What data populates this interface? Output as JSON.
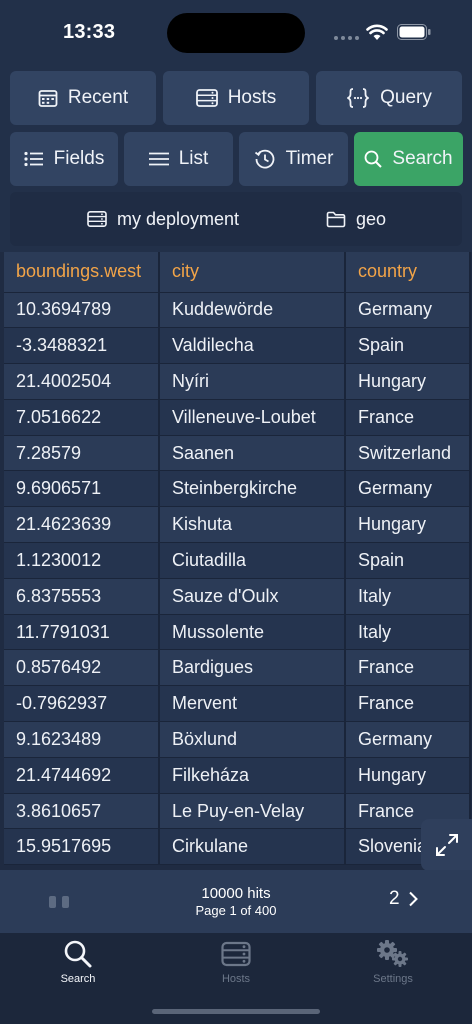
{
  "status": {
    "time": "13:33"
  },
  "toolbar": {
    "recent": "Recent",
    "hosts": "Hosts",
    "query": "Query",
    "fields": "Fields",
    "list": "List",
    "timer": "Timer",
    "search": "Search"
  },
  "deployment": {
    "name": "my deployment",
    "index": "geo"
  },
  "table": {
    "columns": [
      "boundings.west",
      "city",
      "country"
    ],
    "rows": [
      [
        "10.3694789",
        "Kuddewörde",
        "Germany"
      ],
      [
        "-3.3488321",
        "Valdilecha",
        "Spain"
      ],
      [
        "21.4002504",
        "Nyíri",
        "Hungary"
      ],
      [
        "7.0516622",
        "Villeneuve-Loubet",
        "France"
      ],
      [
        "7.28579",
        "Saanen",
        "Switzerland"
      ],
      [
        "9.6906571",
        "Steinbergkirche",
        "Germany"
      ],
      [
        "21.4623639",
        "Kishuta",
        "Hungary"
      ],
      [
        "1.1230012",
        "Ciutadilla",
        "Spain"
      ],
      [
        "6.8375553",
        "Sauze d'Oulx",
        "Italy"
      ],
      [
        "11.7791031",
        "Mussolente",
        "Italy"
      ],
      [
        "0.8576492",
        "Bardigues",
        "France"
      ],
      [
        "-0.7962937",
        "Mervent",
        "France"
      ],
      [
        "9.1623489",
        "Böxlund",
        "Germany"
      ],
      [
        "21.4744692",
        "Filkeháza",
        "Hungary"
      ],
      [
        "3.8610657",
        "Le Puy-en-Velay",
        "France"
      ],
      [
        "15.9517695",
        "Cirkulane",
        "Slovenia"
      ]
    ]
  },
  "pager": {
    "hits": "10000 hits",
    "page_info": "Page 1 of 400",
    "next_page": "2"
  },
  "tabbar": {
    "search": "Search",
    "hosts": "Hosts",
    "settings": "Settings"
  },
  "colors": {
    "background": "#223049",
    "accent_green": "#3ba466",
    "header_orange": "#f2a448"
  },
  "icons": [
    "calendar-icon",
    "server-icon",
    "braces-icon",
    "list-icon",
    "menu-icon",
    "history-icon",
    "search-icon",
    "folder-icon",
    "expand-icon",
    "chevron-right-icon",
    "gears-icon"
  ]
}
